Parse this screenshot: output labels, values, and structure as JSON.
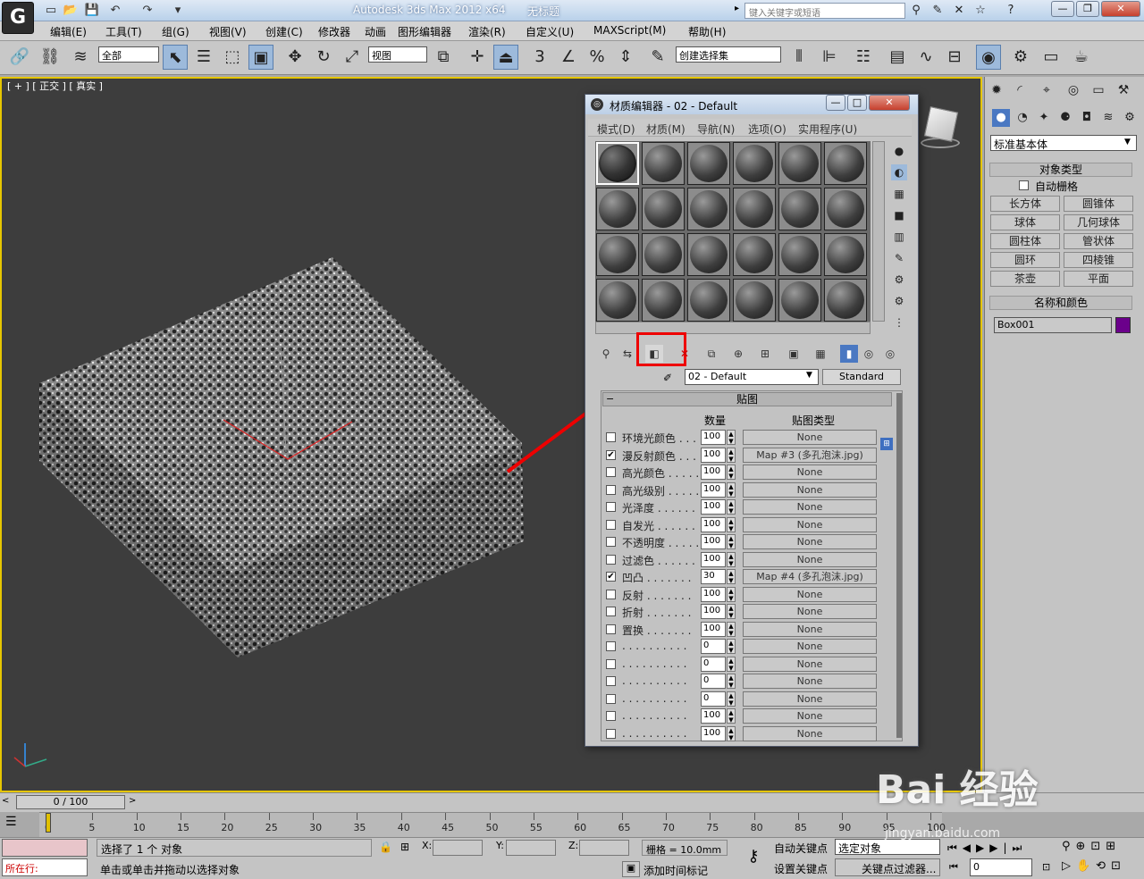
{
  "window": {
    "title": "Autodesk 3ds Max  2012 x64",
    "document": "无标题",
    "search_placeholder": "键入关键字或短语",
    "logo_glyph": "G"
  },
  "menubar": [
    "编辑(E)",
    "工具(T)",
    "组(G)",
    "视图(V)",
    "创建(C)",
    "修改器",
    "动画",
    "图形编辑器",
    "渲染(R)",
    "自定义(U)",
    "MAXScript(M)",
    "帮助(H)"
  ],
  "toolbar": {
    "selection_filter": "全部",
    "reference_coord": "视图",
    "named_selection": "创建选择集",
    "snap_label": "3"
  },
  "viewport": {
    "label": "[ + ] [ 正交 ] [ 真实 ]",
    "name": "正交",
    "shading": "真实"
  },
  "material_editor": {
    "title": "材质编辑器 - 02 - Default",
    "menus": [
      "模式(D)",
      "材质(M)",
      "导航(N)",
      "选项(O)",
      "实用程序(U)"
    ],
    "material_name": "02 - Default",
    "material_type": "Standard",
    "rollout": "贴图",
    "col_amount": "数量",
    "col_map_type": "贴图类型",
    "maps": [
      {
        "label": "环境光颜色 . . . .",
        "checked": false,
        "amount": "100",
        "map": "None"
      },
      {
        "label": "漫反射颜色 . . . .",
        "checked": true,
        "amount": "100",
        "map": "Map #3 (多孔泡沫.jpg)"
      },
      {
        "label": "高光颜色 . . . . .",
        "checked": false,
        "amount": "100",
        "map": "None"
      },
      {
        "label": "高光级别 . . . . .",
        "checked": false,
        "amount": "100",
        "map": "None"
      },
      {
        "label": "光泽度 . . . . . .",
        "checked": false,
        "amount": "100",
        "map": "None"
      },
      {
        "label": "自发光 . . . . . .",
        "checked": false,
        "amount": "100",
        "map": "None"
      },
      {
        "label": "不透明度 . . . . .",
        "checked": false,
        "amount": "100",
        "map": "None"
      },
      {
        "label": "过滤色 . . . . . .",
        "checked": false,
        "amount": "100",
        "map": "None"
      },
      {
        "label": "凹凸 . . . . . . .",
        "checked": true,
        "amount": "30",
        "map": "Map #4 (多孔泡沫.jpg)"
      },
      {
        "label": "反射 . . . . . . .",
        "checked": false,
        "amount": "100",
        "map": "None"
      },
      {
        "label": "折射 . . . . . . .",
        "checked": false,
        "amount": "100",
        "map": "None"
      },
      {
        "label": "置换 . . . . . . .",
        "checked": false,
        "amount": "100",
        "map": "None"
      },
      {
        "label": ". . . . . . . . . .",
        "checked": false,
        "amount": "0",
        "map": "None"
      },
      {
        "label": ". . . . . . . . . .",
        "checked": false,
        "amount": "0",
        "map": "None"
      },
      {
        "label": ". . . . . . . . . .",
        "checked": false,
        "amount": "0",
        "map": "None"
      },
      {
        "label": ". . . . . . . . . .",
        "checked": false,
        "amount": "0",
        "map": "None"
      },
      {
        "label": ". . . . . . . . . .",
        "checked": false,
        "amount": "100",
        "map": "None"
      },
      {
        "label": ". . . . . . . . . .",
        "checked": false,
        "amount": "100",
        "map": "None"
      }
    ]
  },
  "command_panel": {
    "category": "标准基本体",
    "object_type_header": "对象类型",
    "autogrid": "自动栅格",
    "primitives": [
      "长方体",
      "圆锥体",
      "球体",
      "几何球体",
      "圆柱体",
      "管状体",
      "圆环",
      "四棱锥",
      "茶壶",
      "平面"
    ],
    "name_color_header": "名称和颜色",
    "object_name": "Box001",
    "object_color": "#6b008b"
  },
  "timeline": {
    "position": "0 / 100",
    "ticks": [
      "0",
      "5",
      "10",
      "15",
      "20",
      "25",
      "30",
      "35",
      "40",
      "45",
      "50",
      "55",
      "60",
      "65",
      "70",
      "75",
      "80",
      "85",
      "90",
      "95",
      "100"
    ]
  },
  "statusbar": {
    "running_label": "所在行:",
    "selected_text": "选择了 1 个 对象",
    "prompt": "单击或单击并拖动以选择对象",
    "x_label": "X:",
    "y_label": "Y:",
    "z_label": "Z:",
    "grid": "栅格 = 10.0mm",
    "add_time_tag": "添加时间标记",
    "auto_key": "自动关键点",
    "set_key": "设置关键点",
    "selected_object": "选定对象",
    "key_filters": "关键点过滤器...",
    "frame": "0"
  },
  "watermark": {
    "brand": "Bai 经验",
    "url": "jingyan.baidu.com"
  }
}
